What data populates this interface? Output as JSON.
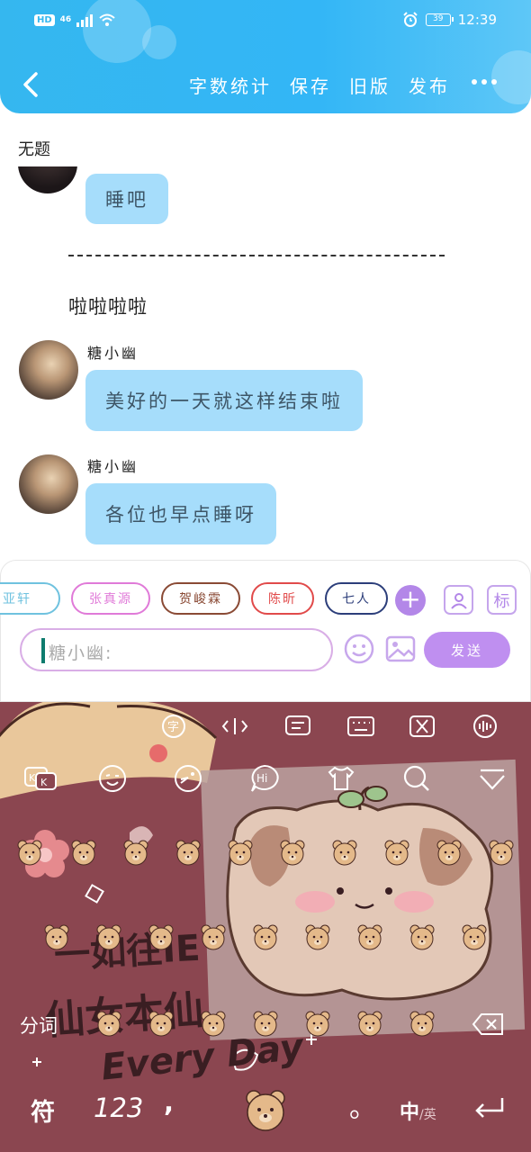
{
  "status_bar": {
    "hd": "HD",
    "network": "46",
    "time": "12:39",
    "battery": "39"
  },
  "header": {
    "actions": [
      "字数统计",
      "保存",
      "旧版",
      "发布"
    ]
  },
  "document": {
    "title": "无题",
    "first_bubble": "睡吧",
    "plain_text": "啦啦啦啦",
    "messages": [
      {
        "sender": "糖小幽",
        "text": "美好的一天就这样结束啦"
      },
      {
        "sender": "糖小幽",
        "text": "各位也早点睡呀"
      }
    ]
  },
  "character_chips": [
    {
      "label": "亚轩",
      "color": "#6fc2df"
    },
    {
      "label": "张真源",
      "color": "#e07ad8"
    },
    {
      "label": "贺峻霖",
      "color": "#8a4a35"
    },
    {
      "label": "陈昕",
      "color": "#e14a4a"
    },
    {
      "label": "七人",
      "color": "#2c3e7a"
    }
  ],
  "input": {
    "placeholder": "糖小幽:",
    "send_label": "发送",
    "tag_label": "标"
  },
  "keyboard": {
    "segment_label": "分词",
    "symbol_key": "符",
    "number_key": "123",
    "comma_key": ",",
    "period_key": "。",
    "lang_primary": "中",
    "lang_secondary": "/英",
    "sticker_line1": "一如往IE",
    "sticker_line2": "仙女本仙",
    "sticker_line3": "Every Day",
    "accent_color": "#8b4650"
  }
}
